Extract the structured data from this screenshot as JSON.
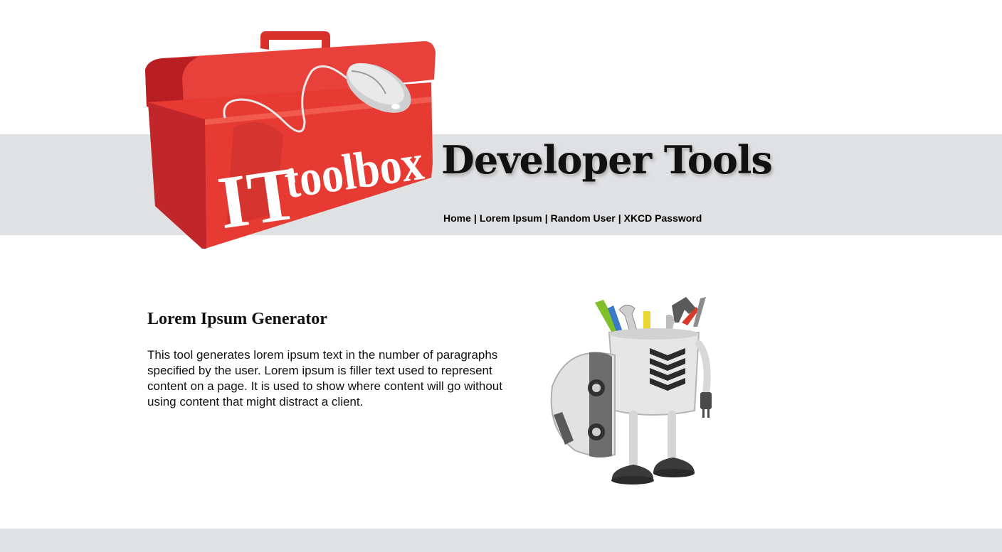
{
  "header": {
    "logo_text_it": "IT",
    "logo_text_toolbox": "toolbox",
    "site_title": "Developer Tools"
  },
  "nav": {
    "items": [
      {
        "label": "Home"
      },
      {
        "label": "Lorem Ipsum"
      },
      {
        "label": "Random User"
      },
      {
        "label": "XKCD Password"
      }
    ],
    "separator": "|"
  },
  "main": {
    "heading": "Lorem Ipsum Generator",
    "description": "This tool generates lorem ipsum text in the number of paragraphs specified by the user. Lorem ipsum is filler text used to represent content on a page. It is used to show where content will go without using content that might distract a client.",
    "illustration": "robot-with-tools-icon"
  },
  "colors": {
    "band": "#e0e1e3",
    "toolbox_red": "#e63a32",
    "text": "#111111"
  }
}
